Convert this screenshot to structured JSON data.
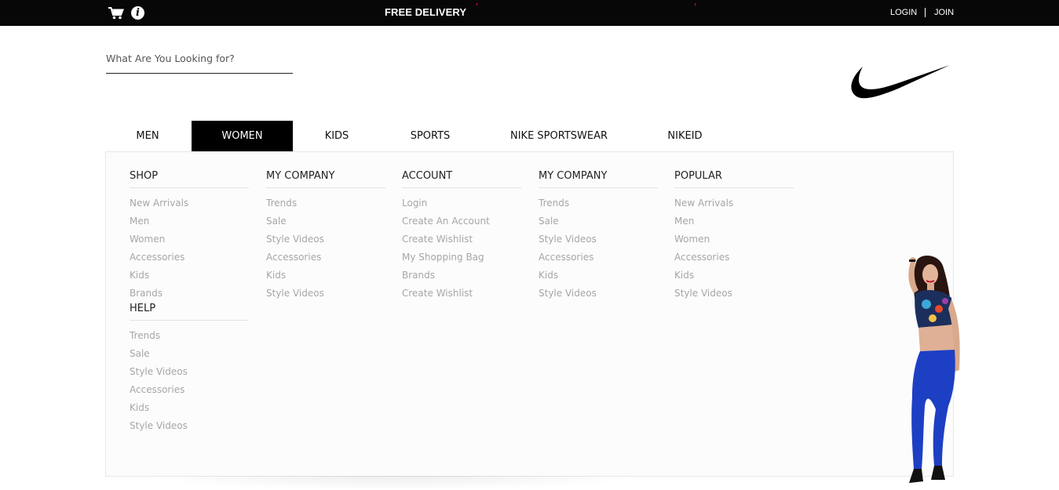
{
  "topbar": {
    "promo": "FREE DELIVERY",
    "cart_icon": "cart-icon",
    "info_icon": "info-icon",
    "info_glyph": "i",
    "login": "LOGIN",
    "join": "JOIN",
    "background": "#070707"
  },
  "search": {
    "placeholder": "What Are You Looking for?",
    "value": ""
  },
  "logo": {
    "icon": "nike-swoosh-icon"
  },
  "nav": {
    "tabs": [
      {
        "label": "MEN"
      },
      {
        "label": "WOMEN",
        "active": true
      },
      {
        "label": "KIDS"
      },
      {
        "label": "SPORTS"
      },
      {
        "label": "NIKE SPORTSWEAR"
      },
      {
        "label": "NIKEID"
      }
    ]
  },
  "menu": {
    "columns": [
      {
        "heading": "SHOP",
        "items": [
          "New Arrivals",
          "Men",
          "Women",
          "Accessories",
          "Kids",
          "Brands"
        ],
        "heading2": "HELP",
        "items2": [
          "Trends",
          "Sale",
          "Style Videos",
          "Accessories",
          "Kids",
          "Style Videos"
        ]
      },
      {
        "heading": "MY COMPANY",
        "items": [
          "Trends",
          "Sale",
          "Style Videos",
          "Accessories",
          "Kids",
          "Style Videos"
        ]
      },
      {
        "heading": "ACCOUNT",
        "items": [
          "Login",
          "Create An Account",
          "Create Wishlist",
          "My Shopping Bag",
          "Brands",
          "Create Wishlist"
        ]
      },
      {
        "heading": "MY COMPANY",
        "items": [
          "Trends",
          "Sale",
          "Style Videos",
          "Accessories",
          "Kids",
          "Style Videos"
        ]
      },
      {
        "heading": "POPULAR",
        "items": [
          "New Arrivals",
          "Men",
          "Women",
          "Accessories",
          "Kids",
          "Style Videos"
        ]
      }
    ]
  },
  "colors": {
    "accent_active_tab": "#000000",
    "menu_link": "#a6a6a6",
    "menu_background": "#fcfcfc"
  }
}
